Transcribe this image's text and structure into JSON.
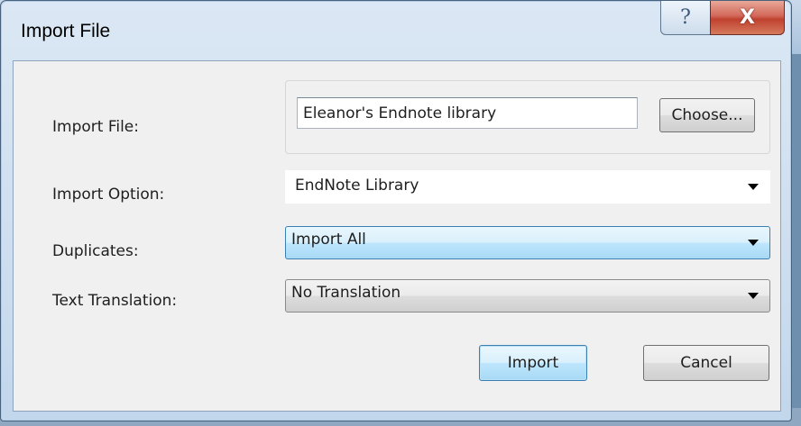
{
  "window": {
    "title": "Import File",
    "help_icon": "help-icon",
    "close_icon": "close-icon",
    "help_glyph": "?",
    "close_glyph": "X"
  },
  "form": {
    "import_file_label": "Import File:",
    "import_file_value": "Eleanor's Endnote library",
    "choose_label": "Choose...",
    "import_option_label": "Import Option:",
    "import_option_value": "EndNote Library",
    "duplicates_label": "Duplicates:",
    "duplicates_value": "Import All",
    "text_translation_label": "Text Translation:",
    "text_translation_value": "No Translation"
  },
  "buttons": {
    "import_label": "Import",
    "cancel_label": "Cancel"
  },
  "colors": {
    "accent_focus": "#3c7fb1",
    "close_red": "#c0412f",
    "dialog_bg": "#f0f0f0"
  }
}
